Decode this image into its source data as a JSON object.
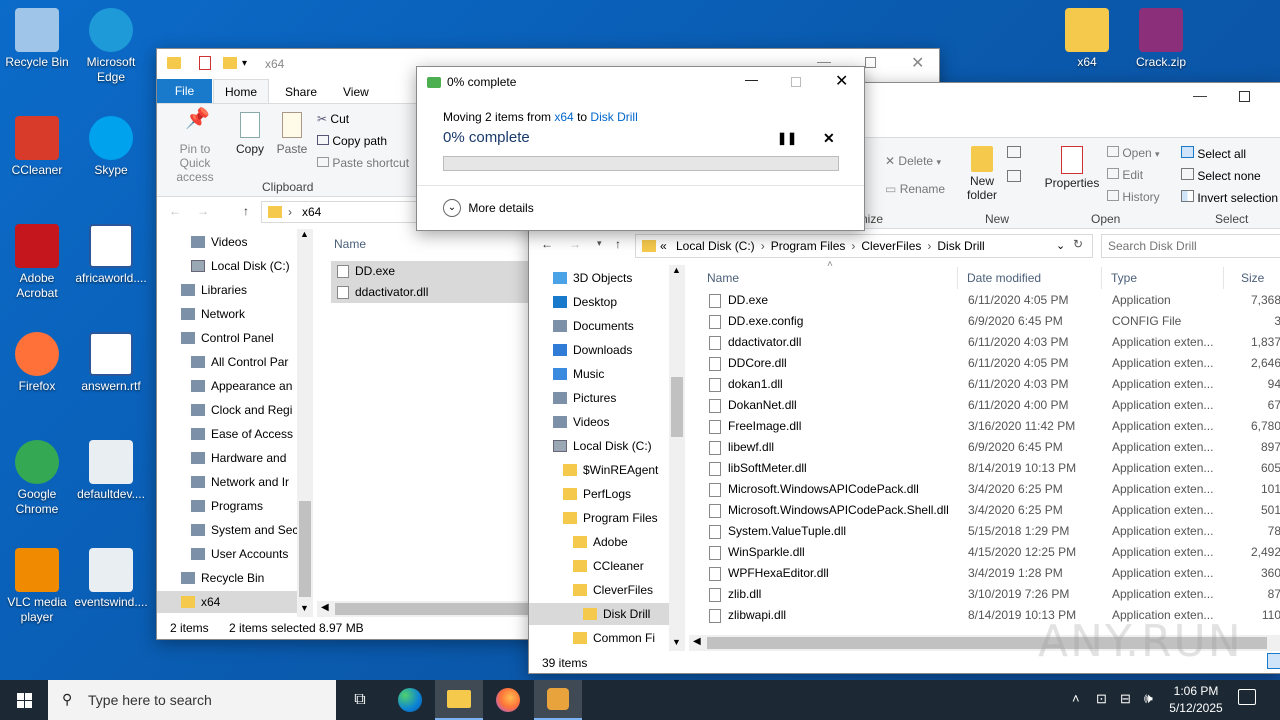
{
  "desktop": {
    "icons": [
      {
        "label": "Recycle Bin",
        "icon": "recycle-bin-icon"
      },
      {
        "label": "Microsoft Edge",
        "icon": "edge-icon"
      },
      {
        "label": "CCleaner",
        "icon": "ccleaner-icon"
      },
      {
        "label": "Skype",
        "icon": "skype-icon"
      },
      {
        "label": "Adobe Acrobat",
        "icon": "acrobat-icon"
      },
      {
        "label": "africaworld....",
        "icon": "word-doc-icon"
      },
      {
        "label": "Firefox",
        "icon": "firefox-icon"
      },
      {
        "label": "answern.rtf",
        "icon": "word-doc-icon"
      },
      {
        "label": "Google Chrome",
        "icon": "chrome-icon"
      },
      {
        "label": "defaultdev....",
        "icon": "image-file-icon"
      },
      {
        "label": "VLC media player",
        "icon": "vlc-icon"
      },
      {
        "label": "eventswind....",
        "icon": "image-file-icon"
      },
      {
        "label": "x64",
        "icon": "folder-icon"
      },
      {
        "label": "Crack.zip",
        "icon": "winrar-icon"
      }
    ]
  },
  "explorer_back": {
    "title": "x64",
    "tabs": {
      "file": "File",
      "home": "Home",
      "share": "Share",
      "view": "View"
    },
    "ribbon": {
      "pin": "Pin to Quick access",
      "copy": "Copy",
      "paste": "Paste",
      "cut": "Cut",
      "copy_path": "Copy path",
      "paste_shortcut": "Paste shortcut",
      "clipboard_group": "Clipboard"
    },
    "address": "x64",
    "column_name": "Name",
    "nav": [
      {
        "label": "Videos",
        "icon": "videos-icon",
        "indent": 2
      },
      {
        "label": "Local Disk (C:)",
        "icon": "drive-icon",
        "indent": 2
      },
      {
        "label": "Libraries",
        "icon": "libraries-icon",
        "indent": 1
      },
      {
        "label": "Network",
        "icon": "network-icon",
        "indent": 1
      },
      {
        "label": "Control Panel",
        "icon": "control-panel-icon",
        "indent": 1
      },
      {
        "label": "All Control Par",
        "icon": "control-panel-icon",
        "indent": 2
      },
      {
        "label": "Appearance an",
        "icon": "appearance-icon",
        "indent": 2
      },
      {
        "label": "Clock and Regi",
        "icon": "clock-icon",
        "indent": 2
      },
      {
        "label": "Ease of Access",
        "icon": "ease-icon",
        "indent": 2
      },
      {
        "label": "Hardware and",
        "icon": "hardware-icon",
        "indent": 2
      },
      {
        "label": "Network and Ir",
        "icon": "network-icon",
        "indent": 2
      },
      {
        "label": "Programs",
        "icon": "programs-icon",
        "indent": 2
      },
      {
        "label": "System and Sec",
        "icon": "security-icon",
        "indent": 2
      },
      {
        "label": "User Accounts",
        "icon": "users-icon",
        "indent": 2
      },
      {
        "label": "Recycle Bin",
        "icon": "recycle-bin-icon",
        "indent": 1
      },
      {
        "label": "x64",
        "icon": "folder-icon",
        "indent": 1
      }
    ],
    "files": [
      {
        "name": "DD.exe",
        "icon": "exe-icon"
      },
      {
        "name": "ddactivator.dll",
        "icon": "dll-icon"
      }
    ],
    "status": {
      "items": "2 items",
      "selected": "2 items selected",
      "size": "8.97 MB"
    }
  },
  "progress_dialog": {
    "title": "0% complete",
    "moving_prefix": "Moving 2 items from ",
    "from": "x64",
    "to_word": " to ",
    "to": "Disk Drill",
    "percent_text": "0% complete",
    "progress": 0,
    "more_details": "More details"
  },
  "explorer_front": {
    "ribbon": {
      "delete": "Delete",
      "rename": "Rename",
      "organize": "nize",
      "new_folder": "New folder",
      "new_group": "New",
      "properties": "Properties",
      "open": "Open",
      "edit": "Edit",
      "history": "History",
      "open_group": "Open",
      "select_all": "Select all",
      "select_none": "Select none",
      "invert": "Invert selection",
      "select_group": "Select"
    },
    "breadcrumb": [
      "Local Disk (C:)",
      "Program Files",
      "CleverFiles",
      "Disk Drill"
    ],
    "search_placeholder": "Search Disk Drill",
    "columns": {
      "name": "Name",
      "date": "Date modified",
      "type": "Type",
      "size": "Size"
    },
    "nav": [
      {
        "label": "3D Objects",
        "icon": "3d-objects-icon",
        "indent": 1
      },
      {
        "label": "Desktop",
        "icon": "desktop-icon",
        "indent": 1
      },
      {
        "label": "Documents",
        "icon": "documents-icon",
        "indent": 1
      },
      {
        "label": "Downloads",
        "icon": "downloads-icon",
        "indent": 1
      },
      {
        "label": "Music",
        "icon": "music-icon",
        "indent": 1
      },
      {
        "label": "Pictures",
        "icon": "pictures-icon",
        "indent": 1
      },
      {
        "label": "Videos",
        "icon": "videos-icon",
        "indent": 1
      },
      {
        "label": "Local Disk (C:)",
        "icon": "drive-icon",
        "indent": 1
      },
      {
        "label": "$WinREAgent",
        "icon": "folder-icon",
        "indent": 2
      },
      {
        "label": "PerfLogs",
        "icon": "folder-icon",
        "indent": 2
      },
      {
        "label": "Program Files",
        "icon": "folder-icon",
        "indent": 2
      },
      {
        "label": "Adobe",
        "icon": "folder-icon",
        "indent": 3
      },
      {
        "label": "CCleaner",
        "icon": "folder-icon",
        "indent": 3
      },
      {
        "label": "CleverFiles",
        "icon": "folder-icon",
        "indent": 3
      },
      {
        "label": "Disk Drill",
        "icon": "folder-icon",
        "indent": 4
      },
      {
        "label": "Common Fi",
        "icon": "folder-icon",
        "indent": 3
      }
    ],
    "files": [
      {
        "name": "DD.exe",
        "date": "6/11/2020 4:05 PM",
        "type": "Application",
        "size": "7,368",
        "icon": "exe-icon"
      },
      {
        "name": "DD.exe.config",
        "date": "6/9/2020 6:45 PM",
        "type": "CONFIG File",
        "size": "3",
        "icon": "file-icon"
      },
      {
        "name": "ddactivator.dll",
        "date": "6/11/2020 4:03 PM",
        "type": "Application exten...",
        "size": "1,837",
        "icon": "dll-icon"
      },
      {
        "name": "DDCore.dll",
        "date": "6/11/2020 4:05 PM",
        "type": "Application exten...",
        "size": "2,646",
        "icon": "dll-icon"
      },
      {
        "name": "dokan1.dll",
        "date": "6/11/2020 4:03 PM",
        "type": "Application exten...",
        "size": "94",
        "icon": "dll-icon"
      },
      {
        "name": "DokanNet.dll",
        "date": "6/11/2020 4:00 PM",
        "type": "Application exten...",
        "size": "67",
        "icon": "dll-icon"
      },
      {
        "name": "FreeImage.dll",
        "date": "3/16/2020 11:42 PM",
        "type": "Application exten...",
        "size": "6,780",
        "icon": "dll-icon"
      },
      {
        "name": "libewf.dll",
        "date": "6/9/2020 6:45 PM",
        "type": "Application exten...",
        "size": "897",
        "icon": "dll-icon"
      },
      {
        "name": "libSoftMeter.dll",
        "date": "8/14/2019 10:13 PM",
        "type": "Application exten...",
        "size": "605",
        "icon": "dll-icon"
      },
      {
        "name": "Microsoft.WindowsAPICodePack.dll",
        "date": "3/4/2020 6:25 PM",
        "type": "Application exten...",
        "size": "101",
        "icon": "dll-icon"
      },
      {
        "name": "Microsoft.WindowsAPICodePack.Shell.dll",
        "date": "3/4/2020 6:25 PM",
        "type": "Application exten...",
        "size": "501",
        "icon": "dll-icon"
      },
      {
        "name": "System.ValueTuple.dll",
        "date": "5/15/2018 1:29 PM",
        "type": "Application exten...",
        "size": "78",
        "icon": "dll-icon"
      },
      {
        "name": "WinSparkle.dll",
        "date": "4/15/2020 12:25 PM",
        "type": "Application exten...",
        "size": "2,492",
        "icon": "dll-icon"
      },
      {
        "name": "WPFHexaEditor.dll",
        "date": "3/4/2019 1:28 PM",
        "type": "Application exten...",
        "size": "360",
        "icon": "dll-icon"
      },
      {
        "name": "zlib.dll",
        "date": "3/10/2019 7:26 PM",
        "type": "Application exten...",
        "size": "87",
        "icon": "dll-icon"
      },
      {
        "name": "zlibwapi.dll",
        "date": "8/14/2019 10:13 PM",
        "type": "Application exten...",
        "size": "110",
        "icon": "dll-icon"
      }
    ],
    "status": {
      "items": "39 items"
    }
  },
  "taskbar": {
    "search_placeholder": "Type here to search",
    "time": "1:06 PM",
    "date": "5/12/2025"
  },
  "watermark": "ANY.RUN"
}
